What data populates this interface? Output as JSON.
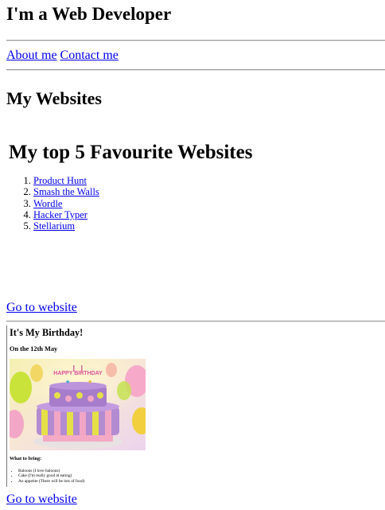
{
  "header": {
    "title": "I'm a Web Developer"
  },
  "nav": {
    "about": "About me",
    "contact": "Contact me"
  },
  "sites_heading": "My Websites",
  "favourites": {
    "heading": "My top 5 Favourite Websites",
    "items": [
      "Product Hunt",
      "Smash the Walls",
      "Wordle",
      "Hacker Typer",
      "Stellarium"
    ]
  },
  "go_link_1": "Go to website",
  "birthday": {
    "title": "It's My Birthday!",
    "date": "On the 12th May",
    "cake_text": "HAPPY BIRTHDAY",
    "bring_label": "What to bring:",
    "bring_items": [
      "Baloons (I love baloons)",
      "Cake (I'm really good at eating)",
      "An appetite (There will be lots of food)"
    ]
  },
  "go_link_2": "Go to website"
}
